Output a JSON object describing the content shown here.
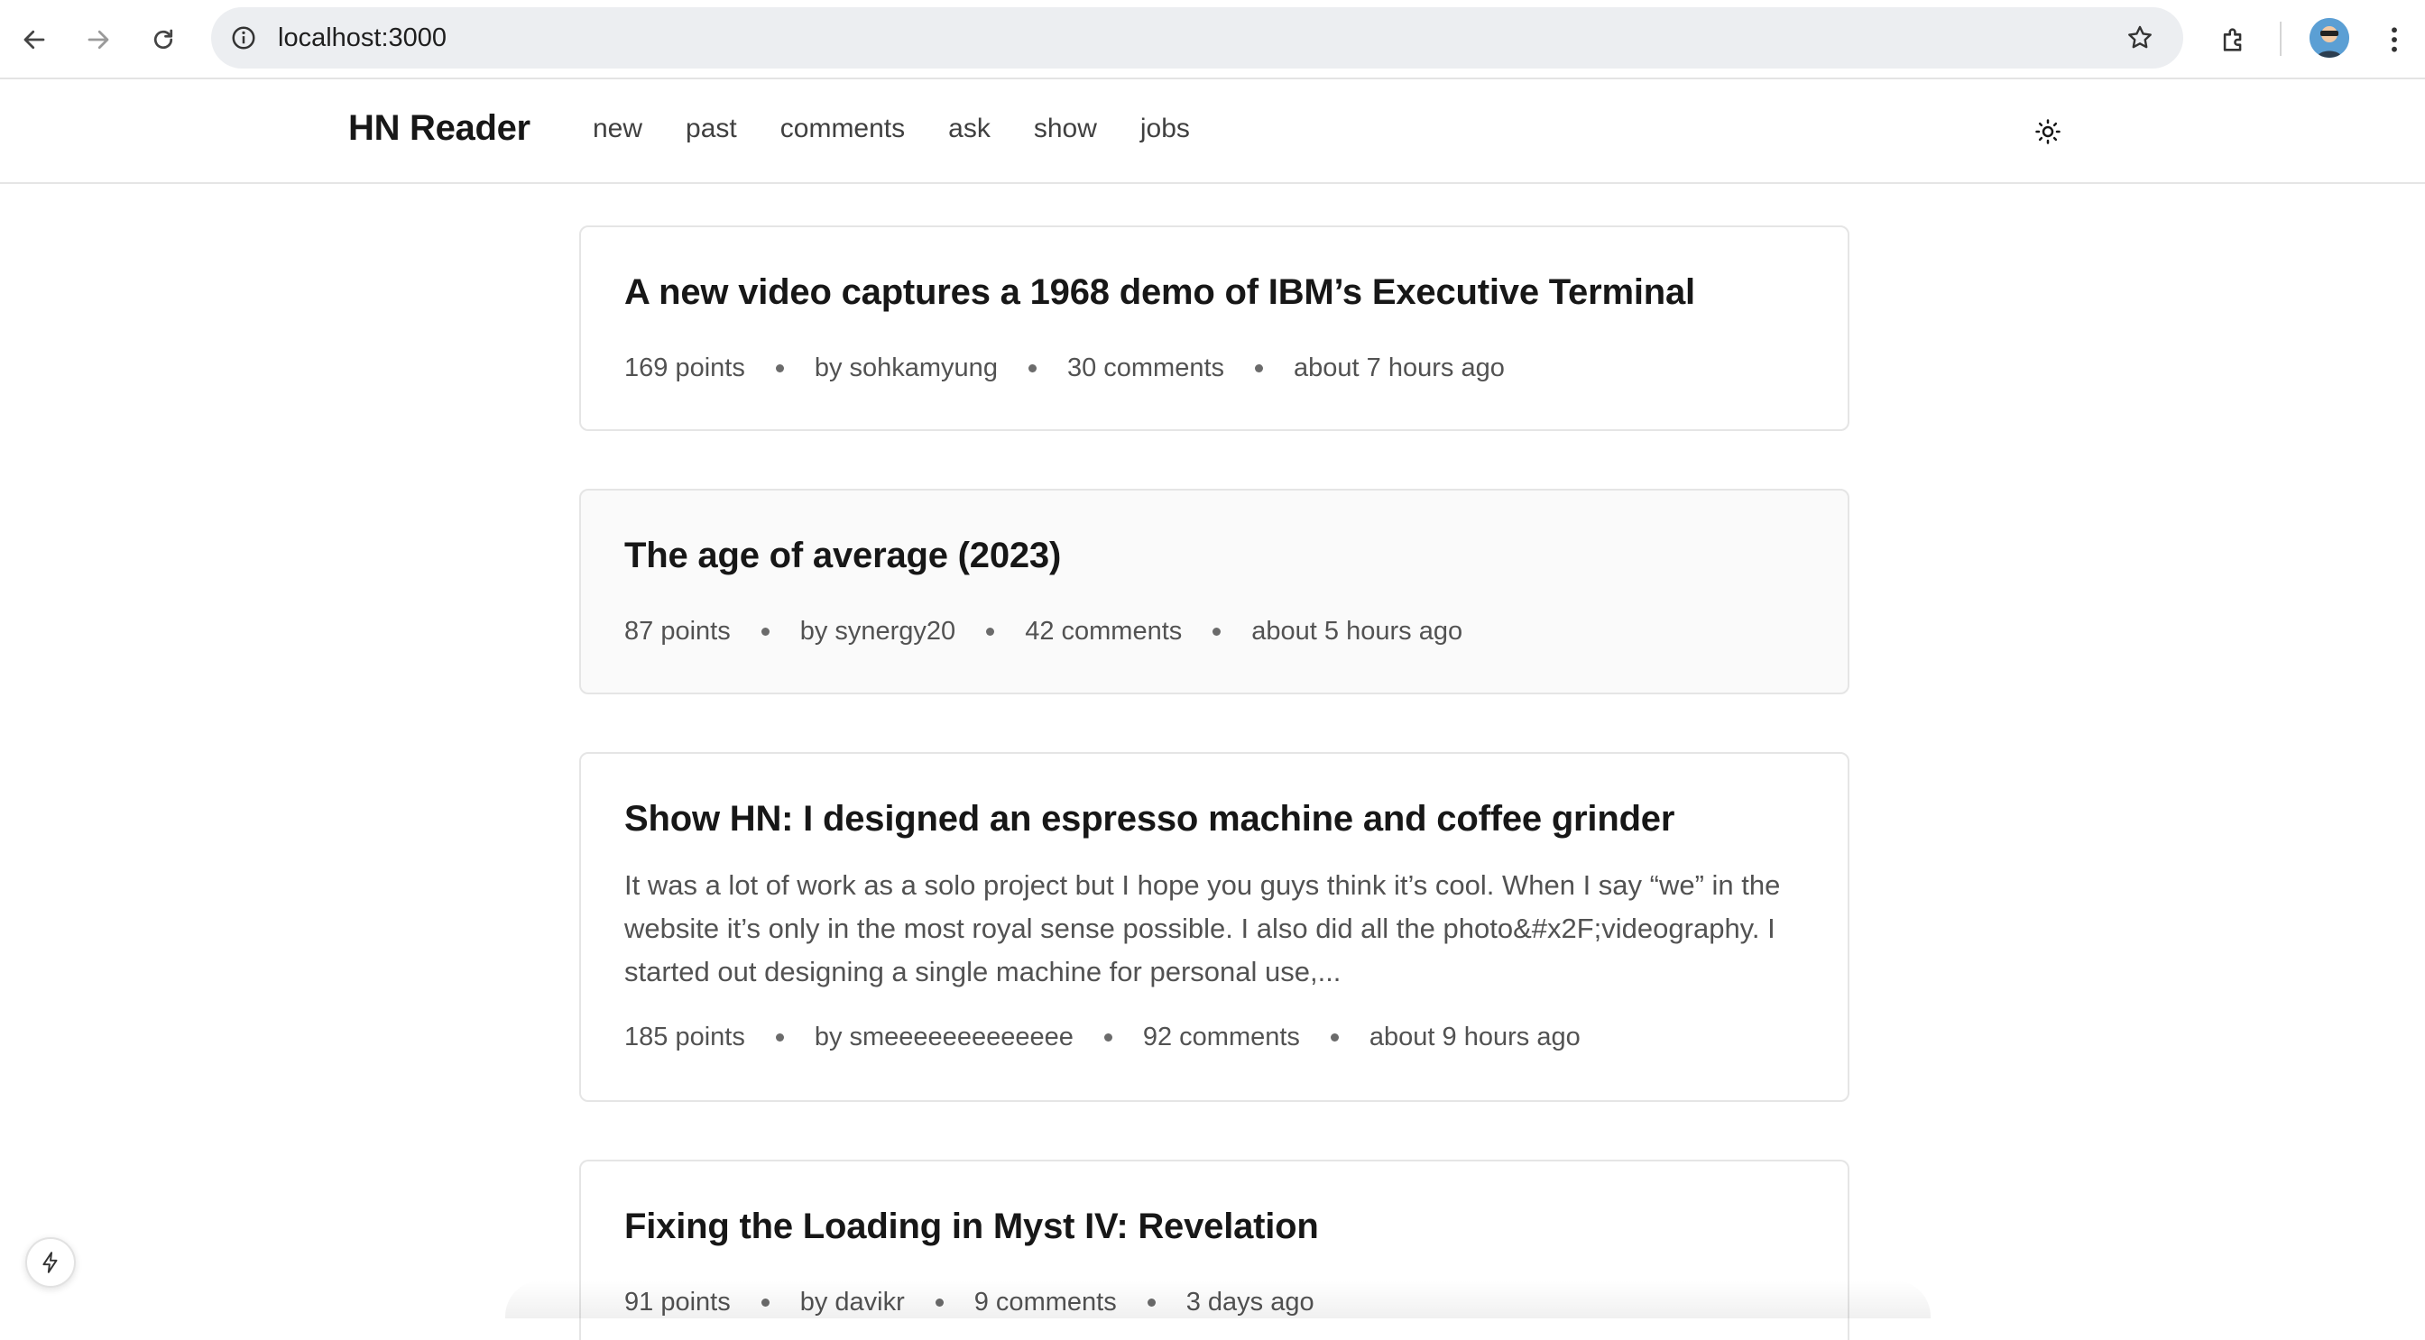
{
  "browser": {
    "url": "localhost:3000",
    "icons": [
      "back-icon",
      "forward-icon",
      "reload-icon",
      "info-icon",
      "star-icon",
      "extensions-icon",
      "profile-avatar",
      "more-menu-icon"
    ]
  },
  "header": {
    "brand": "HN Reader",
    "nav": [
      "new",
      "past",
      "comments",
      "ask",
      "show",
      "jobs"
    ],
    "theme_icon": "sun-icon"
  },
  "stories": [
    {
      "title": "A new video captures a 1968 demo of IBM’s Executive Terminal",
      "excerpt": "",
      "points": "169 points",
      "by": "by sohkamyung",
      "comments": "30 comments",
      "time": "about 7 hours ago"
    },
    {
      "title": "The age of average (2023)",
      "excerpt": "",
      "points": "87 points",
      "by": "by synergy20",
      "comments": "42 comments",
      "time": "about 5 hours ago"
    },
    {
      "title": "Show HN: I designed an espresso machine and coffee grinder",
      "excerpt": "It was a lot of work as a solo project but I hope you guys think it’s cool. When I say “we” in the website it’s only in the most royal sense possible. I also did all the photo&#x2F;videography. I started out designing a single machine for personal use,...",
      "points": "185 points",
      "by": "by smeeeeeeeeeeeee",
      "comments": "92 comments",
      "time": "about 9 hours ago"
    },
    {
      "title": "Fixing the Loading in Myst IV: Revelation",
      "excerpt": "",
      "points": "91 points",
      "by": "by davikr",
      "comments": "9 comments",
      "time": "3 days ago"
    }
  ],
  "colors": {
    "text": "#171717",
    "muted": "#525252",
    "border": "#e5e5e5",
    "hover_bg": "#fafafa"
  }
}
